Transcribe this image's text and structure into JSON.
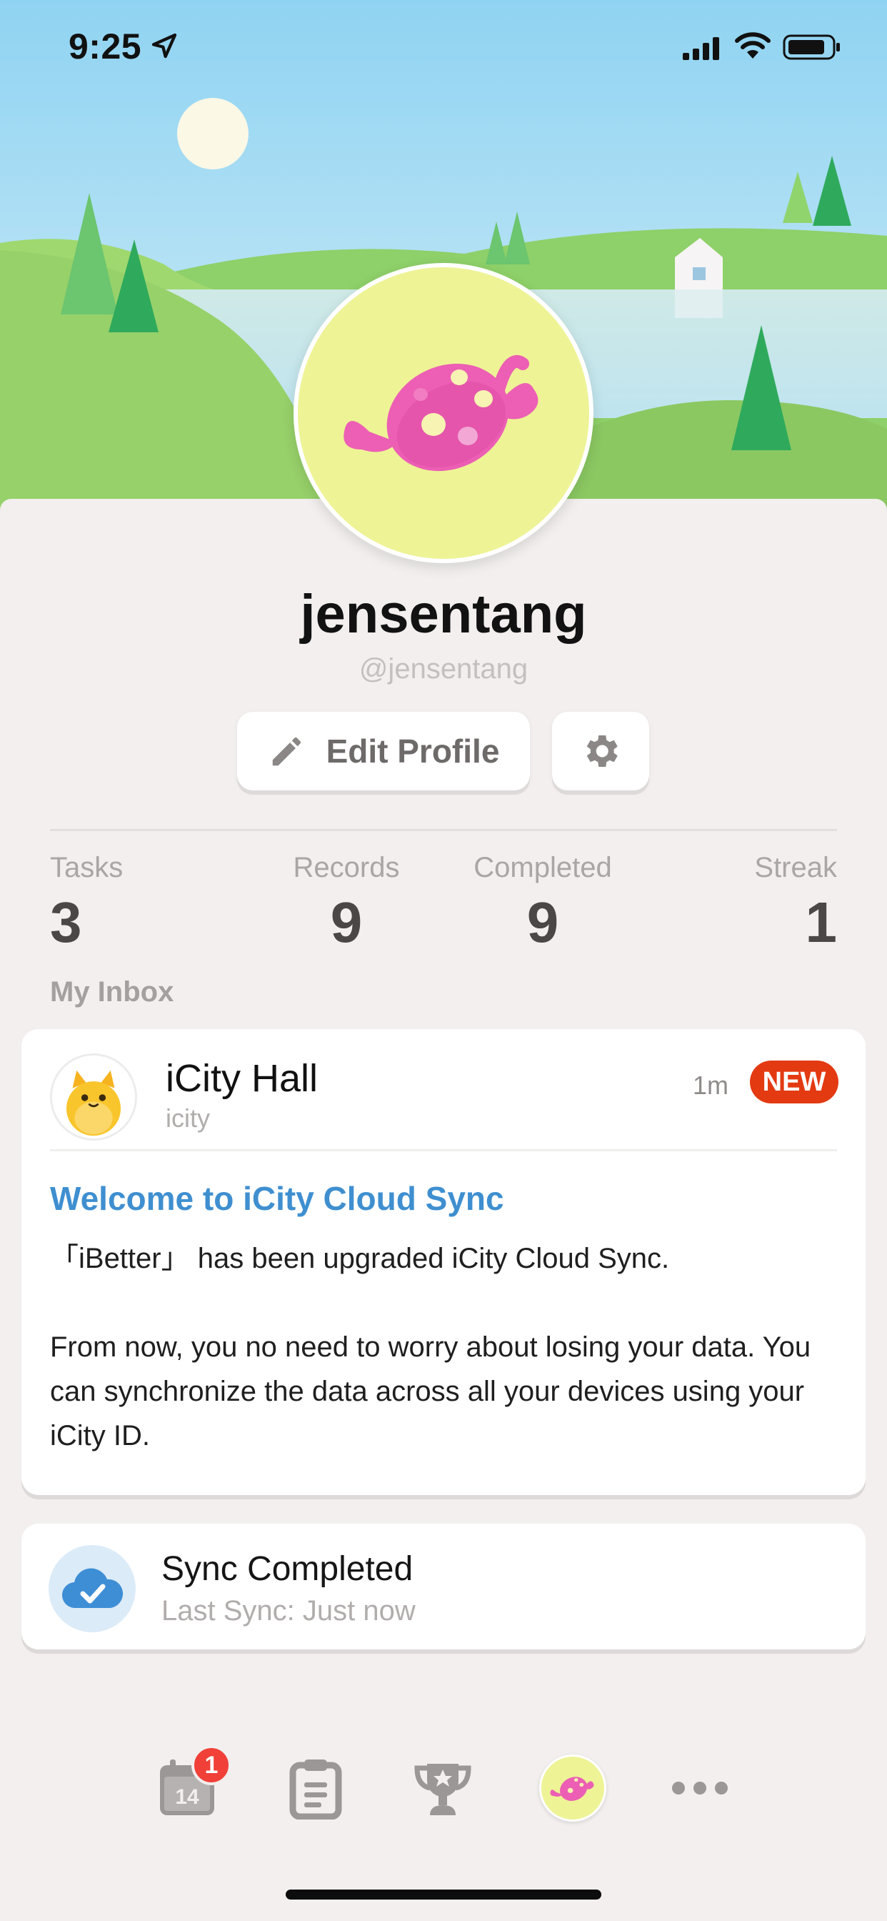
{
  "status_bar": {
    "time": "9:25"
  },
  "profile": {
    "display_name": "jensentang",
    "handle": "@jensentang",
    "edit_button_label": "Edit Profile"
  },
  "stats": [
    {
      "label": "Tasks",
      "value": "3"
    },
    {
      "label": "Records",
      "value": "9"
    },
    {
      "label": "Completed",
      "value": "9"
    },
    {
      "label": "Streak",
      "value": "1"
    }
  ],
  "inbox": {
    "section_title": "My Inbox",
    "message": {
      "sender_name": "iCity Hall",
      "sender_handle": "icity",
      "time": "1m",
      "badge": "NEW",
      "title": "Welcome to iCity Cloud Sync",
      "body": "「iBetter」 has been upgraded iCity Cloud Sync.\n\nFrom now, you no need to worry about losing your data. You can synchronize the data across all your devices using your iCity ID."
    }
  },
  "sync": {
    "title": "Sync Completed",
    "subtitle": "Last Sync: Just now"
  },
  "tabbar": {
    "calendar_date": "14",
    "calendar_badge": "1",
    "items": [
      "calendar-icon",
      "clipboard-icon",
      "trophy-icon",
      "candy-avatar",
      "more-dots-icon"
    ]
  },
  "colors": {
    "accent_blue": "#3f8fd0",
    "new_badge": "#e33a12",
    "avatar_bg": "#eef396",
    "candy_pink": "#ec5fb4"
  }
}
